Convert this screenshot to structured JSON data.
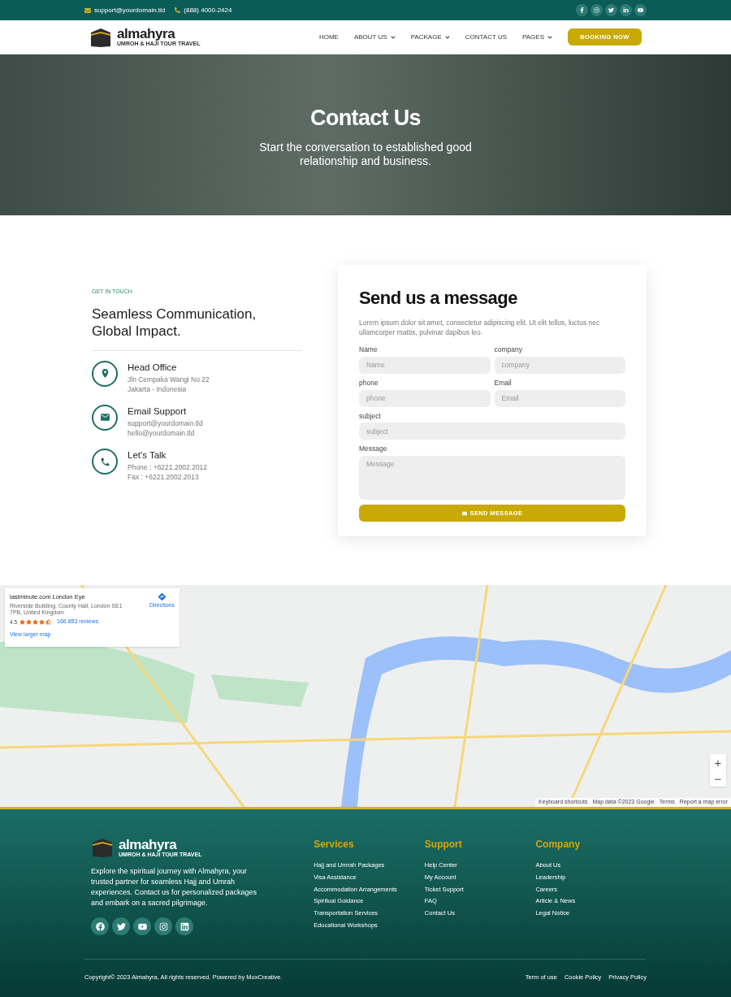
{
  "top_bar": {
    "email": "support@yourdomain.tld",
    "phone": "(888) 4000-2424"
  },
  "brand": {
    "name": "almahyra",
    "tagline": "UMROH & HAJI TOUR TRAVEL"
  },
  "nav": {
    "items": [
      {
        "label": "HOME",
        "dropdown": false
      },
      {
        "label": "ABOUT US",
        "dropdown": true
      },
      {
        "label": "PACKAGE",
        "dropdown": true
      },
      {
        "label": "CONTACT US",
        "dropdown": false
      },
      {
        "label": "PAGES",
        "dropdown": true
      }
    ],
    "cta": "BOOKING NOW"
  },
  "hero": {
    "title": "Contact Us",
    "subtitle": "Start the conversation to established good relationship and business."
  },
  "contact": {
    "eyebrow": "GET IN TOUCH",
    "heading": "Seamless Communication, Global Impact.",
    "items": [
      {
        "kind": "location",
        "title": "Head Office",
        "lines": [
          "Jln Cempaka Wangi No 22",
          "Jakarta - Indonesia"
        ]
      },
      {
        "kind": "email",
        "title": "Email Support",
        "lines": [
          "support@yourdomain.tld",
          "hello@yourdomain.tld"
        ]
      },
      {
        "kind": "phone",
        "title": "Let's Talk",
        "lines": [
          "Phone : +6221.2002.2012",
          "Fax : +6221.2002.2013"
        ]
      }
    ]
  },
  "form": {
    "title": "Send us a message",
    "intro": "Lorem ipsum dolor sit amet, consectetur adipiscing elit. Ut elit tellus, luctus nec ullamcorper mattis, pulvinar dapibus leo.",
    "rows": [
      [
        {
          "kind": "input",
          "label": "Name",
          "placeholder": "Name"
        },
        {
          "kind": "input",
          "label": "company",
          "placeholder": "company"
        }
      ],
      [
        {
          "kind": "input",
          "label": "phone",
          "placeholder": "phone"
        },
        {
          "kind": "input",
          "label": "Email",
          "placeholder": "Email"
        }
      ],
      [
        {
          "kind": "input",
          "label": "subject",
          "placeholder": "subject"
        }
      ],
      [
        {
          "kind": "textarea",
          "label": "Message",
          "placeholder": "Message"
        }
      ]
    ],
    "submit": "SEND MESSAGE"
  },
  "map": {
    "place": {
      "name": "lastminute.com London Eye",
      "address": "Riverside Building, County Hall, London SE1 7PB, United Kingdom",
      "rating": "4.5",
      "stars": 4.5,
      "reviews": "166.853 reviews",
      "directions": "Directions",
      "larger_map": "View larger map"
    },
    "zoom_in": "+",
    "zoom_out": "−",
    "attribution": [
      "Keyboard shortcuts",
      "Map data ©2023 Google",
      "Terms",
      "Report a map error"
    ]
  },
  "footer": {
    "about": "Explore the spiritual journey with Almahyra, your trusted partner for seamless Hajj and Umrah experiences. Contact us for personalized packages and embark on a sacred pilgrimage.",
    "columns": [
      {
        "title": "Services",
        "links": [
          "Hajj and Umrah Packages",
          "Visa Assistance",
          "Accommodation Arrangements",
          "Spiritual Guidance",
          "Transportation Services",
          "Educational Workshops"
        ]
      },
      {
        "title": "Support",
        "links": [
          "Help Center",
          "My Account",
          "Ticket Support",
          "FAQ",
          "Contact Us"
        ]
      },
      {
        "title": "Company",
        "links": [
          "About Us",
          "Leadership",
          "Careers",
          "Article & News",
          "Legal Notice"
        ]
      }
    ],
    "brand": {
      "name": "almahyra",
      "tagline": "UMROH & HAJI TOUR TRAVEL"
    },
    "copyright": "Copyright© 2023 Almahyra, All rights reserved. Powered by MoxCreative.",
    "legal": [
      "Term of use",
      "Cookie Policy",
      "Privacy Policy"
    ]
  }
}
